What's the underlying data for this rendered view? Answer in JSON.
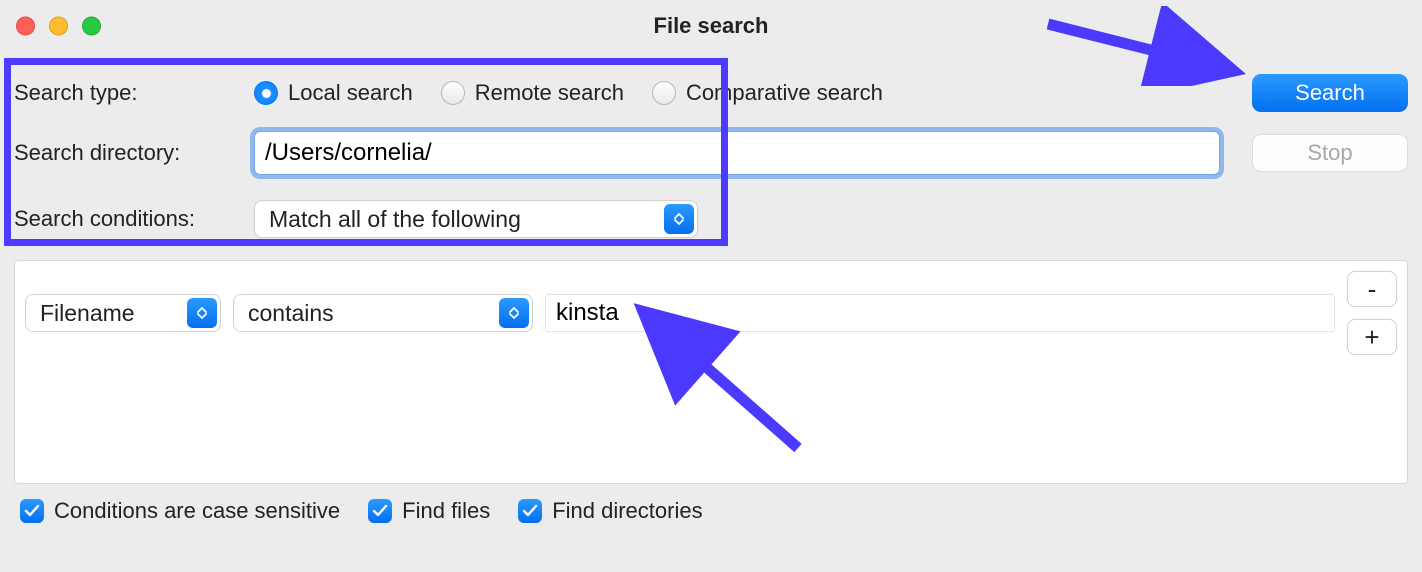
{
  "window": {
    "title": "File search"
  },
  "labels": {
    "search_type": "Search type:",
    "search_directory": "Search directory:",
    "search_conditions": "Search conditions:"
  },
  "search_type": {
    "options": [
      {
        "key": "local",
        "label": "Local search",
        "checked": true
      },
      {
        "key": "remote",
        "label": "Remote search",
        "checked": false
      },
      {
        "key": "comparative",
        "label": "Comparative search",
        "checked": false
      }
    ]
  },
  "search_directory": {
    "value": "/Users/cornelia/"
  },
  "search_conditions": {
    "selected": "Match all of the following"
  },
  "actions": {
    "search": "Search",
    "stop": "Stop"
  },
  "condition_row": {
    "field": "Filename",
    "op": "contains",
    "value": "kinsta",
    "remove_label": "-",
    "add_label": "+"
  },
  "checks": {
    "case_sensitive": "Conditions are case sensitive",
    "find_files": "Find files",
    "find_dirs": "Find directories"
  }
}
